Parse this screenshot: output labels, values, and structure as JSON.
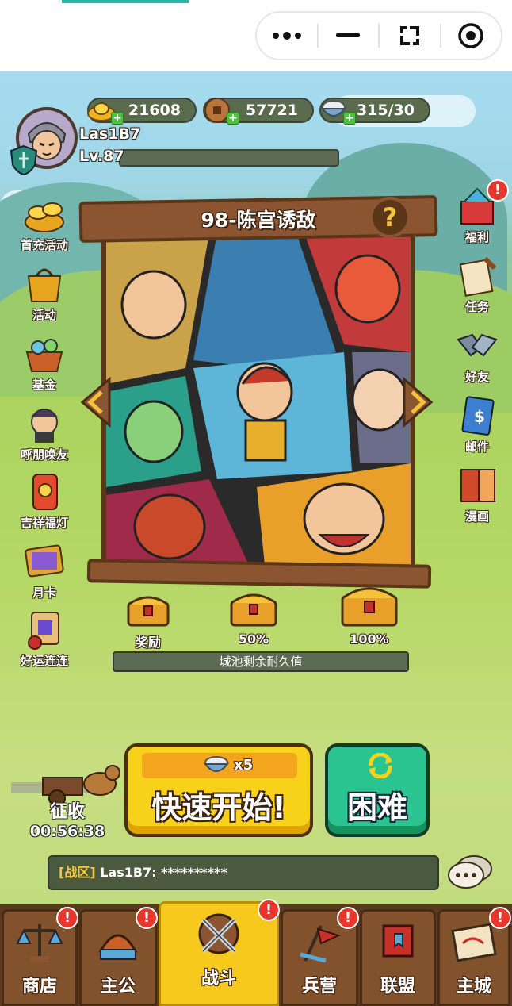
{
  "currency": {
    "gold": "21608",
    "coins": "57721",
    "stamina": "315/30"
  },
  "player": {
    "name": "Las1B7",
    "level": "Lv.87"
  },
  "left_menu": [
    {
      "label": "首充活动",
      "icon": "gold-ingots-icon"
    },
    {
      "label": "活动",
      "icon": "gift-bag-icon"
    },
    {
      "label": "基金",
      "icon": "treasure-basket-icon"
    },
    {
      "label": "呼朋唤友",
      "icon": "friend-invite-icon"
    },
    {
      "label": "吉祥福灯",
      "icon": "lucky-lantern-icon"
    },
    {
      "label": "月卡",
      "icon": "month-card-icon"
    },
    {
      "label": "好运连连",
      "icon": "lucky-scroll-icon"
    }
  ],
  "right_menu": [
    {
      "label": "福利",
      "icon": "welfare-gift-icon",
      "badge": "!"
    },
    {
      "label": "任务",
      "icon": "task-scroll-icon"
    },
    {
      "label": "好友",
      "icon": "handshake-icon"
    },
    {
      "label": "邮件",
      "icon": "mail-icon"
    },
    {
      "label": "漫画",
      "icon": "comic-book-icon"
    }
  ],
  "stage": {
    "title": "98-陈宫诱敌",
    "help": "?"
  },
  "chests": [
    {
      "label": "奖励"
    },
    {
      "label": "50%"
    },
    {
      "label": "100%"
    }
  ],
  "durability_label": "城池剩余耐久值",
  "quick_start": {
    "cost": "x5",
    "label": "快速开始!"
  },
  "hard_label": "困难",
  "collect": {
    "label": "征收",
    "timer": "00:56:38"
  },
  "chat": {
    "channel": "[战区]",
    "message": " Las1B7: **********"
  },
  "nav": [
    {
      "label": "商店",
      "icon": "shop-scale-icon",
      "badge": "!"
    },
    {
      "label": "主公",
      "icon": "lord-helmet-icon",
      "badge": "!"
    },
    {
      "label": "战斗",
      "icon": "crossed-swords-icon",
      "badge": "!",
      "active": true
    },
    {
      "label": "兵营",
      "icon": "barracks-flag-icon",
      "badge": "!"
    },
    {
      "label": "联盟",
      "icon": "alliance-banner-icon"
    },
    {
      "label": "主城",
      "icon": "city-map-icon",
      "badge": "!"
    }
  ],
  "colors": {
    "quick_start": "#f7d11a",
    "hard": "#29c48f",
    "badge": "#e7362c",
    "nav_active": "#f6c91c",
    "wood": "#8a5530"
  }
}
